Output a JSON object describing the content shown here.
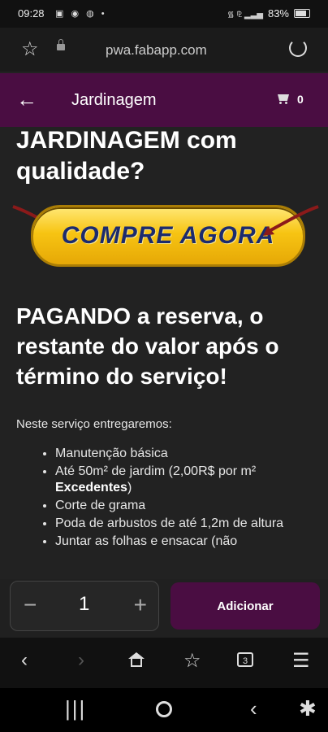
{
  "status_bar": {
    "time": "09:28",
    "notifications": "▣ ◉ ◍ •",
    "signal": "᯾ ⅊ ▂▃▅",
    "battery": "83%"
  },
  "browser": {
    "url": "pwa.fabapp.com"
  },
  "app_header": {
    "title": "Jardinagem",
    "cart_count": "0"
  },
  "content": {
    "heading1": "JARDINAGEM com qualidade?",
    "cta_label": "COMPRE AGORA",
    "heading2": "PAGANDO a reserva, o restante do valor após o término do serviço!",
    "intro": "Neste serviço entregaremos:",
    "features": [
      "Manutenção básica",
      "Até 50m² de jardim (2,00R$ por m²",
      "Excedentes",
      ")",
      "Corte de grama",
      "Poda de arbustos de até 1,2m de altura",
      "Juntar as folhas e ensacar (não"
    ]
  },
  "action_bar": {
    "quantity": "1",
    "minus": "−",
    "plus": "+",
    "add_label": "Adicionar"
  },
  "browser_nav": {
    "tabs_count": "3"
  },
  "colors": {
    "brand_purple": "#4a0d42",
    "background": "#222222",
    "cta_yellow": "#f7c413",
    "cta_text": "#1c2b6e"
  }
}
